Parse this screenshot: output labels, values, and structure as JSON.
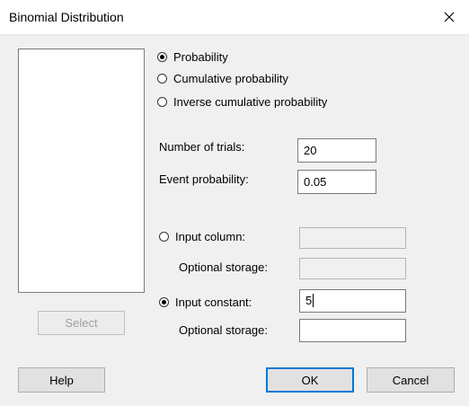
{
  "window": {
    "title": "Binomial Distribution",
    "close_glyph": "✕"
  },
  "buttons": {
    "select": "Select",
    "help": "Help",
    "ok": "OK",
    "cancel": "Cancel"
  },
  "mode": {
    "options": [
      "Probability",
      "Cumulative probability",
      "Inverse cumulative probability"
    ],
    "selected": "Probability"
  },
  "params": {
    "trials_label": "Number of trials:",
    "trials_value": "20",
    "event_label": "Event probability:",
    "event_value": "0.05"
  },
  "input": {
    "column_label": "Input column:",
    "column_storage_label": "Optional storage:",
    "constant_label": "Input constant:",
    "constant_value": "5",
    "constant_storage_label": "Optional storage:",
    "selected": "Input constant"
  }
}
